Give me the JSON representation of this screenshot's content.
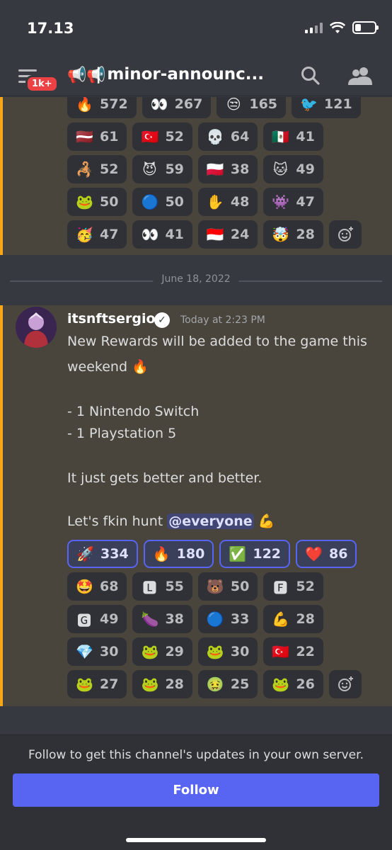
{
  "status": {
    "time": "17.13"
  },
  "header": {
    "badge": "1k+",
    "channel_title": "| minor-announc...",
    "channel_icons": "📢📢"
  },
  "top_reactions": [
    {
      "emoji": "🔥",
      "count": "572"
    },
    {
      "emoji": "👀",
      "count": "267"
    },
    {
      "emoji": "😒",
      "count": "165"
    },
    {
      "emoji": "🐦",
      "count": "121"
    },
    {
      "emoji": "🇱🇻",
      "count": "61"
    },
    {
      "emoji": "🇹🇷",
      "count": "52"
    },
    {
      "emoji": "💀",
      "count": "64"
    },
    {
      "emoji": "🇲🇽",
      "count": "41"
    },
    {
      "emoji": "🦂",
      "count": "52"
    },
    {
      "emoji": "😈",
      "count": "59"
    },
    {
      "emoji": "🇵🇱",
      "count": "38"
    },
    {
      "emoji": "🐱",
      "count": "49"
    },
    {
      "emoji": "🐸",
      "count": "50"
    },
    {
      "emoji": "🔵",
      "count": "50"
    },
    {
      "emoji": "✋",
      "count": "48"
    },
    {
      "emoji": "👾",
      "count": "47"
    },
    {
      "emoji": "🥳",
      "count": "47"
    },
    {
      "emoji": "👀",
      "count": "41"
    },
    {
      "emoji": "🇮🇩",
      "count": "24"
    },
    {
      "emoji": "🤯",
      "count": "28"
    }
  ],
  "date_divider": "June 18, 2022",
  "message": {
    "username": "itsnftsergio",
    "timestamp": "Today at 2:23 PM",
    "line1": "New Rewards will be added to the game this",
    "line2": "weekend 🔥",
    "line3": "- 1 Nintendo Switch",
    "line4": "- 1 Playstation 5",
    "line5": "It just gets better and better.",
    "line6_prefix": "Let's fkin hunt ",
    "mention": "@everyone",
    "line6_suffix": " 💪"
  },
  "message_reactions": [
    {
      "emoji": "🚀",
      "count": "334",
      "me": true
    },
    {
      "emoji": "🔥",
      "count": "180",
      "me": true
    },
    {
      "emoji": "✅",
      "count": "122",
      "me": true
    },
    {
      "emoji": "❤️",
      "count": "86",
      "me": true
    },
    {
      "emoji": "🤩",
      "count": "68"
    },
    {
      "emoji": "🅻",
      "count": "55"
    },
    {
      "emoji": "🐻",
      "count": "50"
    },
    {
      "emoji": "🅵",
      "count": "52"
    },
    {
      "emoji": "🅶",
      "count": "49"
    },
    {
      "emoji": "🍆",
      "count": "38"
    },
    {
      "emoji": "🔵",
      "count": "33"
    },
    {
      "emoji": "💪",
      "count": "28"
    },
    {
      "emoji": "💎",
      "count": "30"
    },
    {
      "emoji": "🐸",
      "count": "29"
    },
    {
      "emoji": "🐸",
      "count": "30"
    },
    {
      "emoji": "🇹🇷",
      "count": "22"
    },
    {
      "emoji": "🐸",
      "count": "27"
    },
    {
      "emoji": "🐸",
      "count": "28"
    },
    {
      "emoji": "🤢",
      "count": "25"
    },
    {
      "emoji": "🐸",
      "count": "26"
    }
  ],
  "follow": {
    "text": "Follow to get this channel's updates in your own server.",
    "button": "Follow"
  },
  "colors": {
    "accent": "#5865f2",
    "highlight_border": "#faa61a",
    "mention_bg": "#414675"
  }
}
